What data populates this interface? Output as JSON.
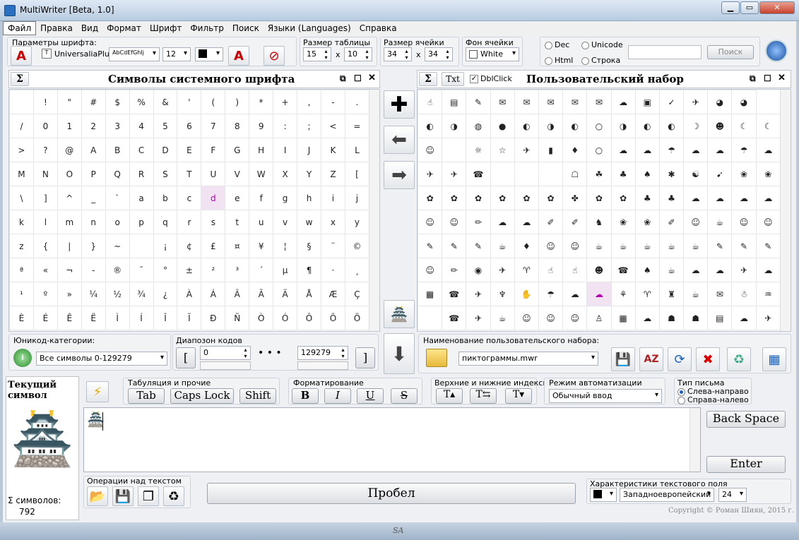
{
  "window": {
    "title": "MultiWriter [Beta, 1.0]"
  },
  "menu": [
    "Файл",
    "Правка",
    "Вид",
    "Формат",
    "Шрифт",
    "Фильтр",
    "Поиск",
    "Языки (Languages)",
    "Справка"
  ],
  "font_params": {
    "label": "Параметры шрифта:",
    "font_name": "UniversaliaPlus",
    "font_sample": "AbCdEfGhIj",
    "font_size": "12"
  },
  "table_size": {
    "label": "Размер таблицы",
    "cols": "15",
    "x": "x",
    "rows": "10"
  },
  "cell_size": {
    "label": "Размер ячейки",
    "w": "34",
    "x": "x",
    "h": "34"
  },
  "cell_bg": {
    "label": "Фон ячейки",
    "value": "White"
  },
  "search": {
    "dec": "Dec",
    "unicode": "Unicode",
    "html": "Html",
    "string": "Строка",
    "button": "Поиск",
    "value": ""
  },
  "system_panel": {
    "sigma": "Σ",
    "title": "Символы системного шрифта"
  },
  "system_grid": [
    [
      "",
      "!",
      "\"",
      "#",
      "$",
      "%",
      "&",
      "'",
      "(",
      ")",
      "*",
      "+",
      ",",
      "-",
      "."
    ],
    [
      "/",
      "0",
      "1",
      "2",
      "3",
      "4",
      "5",
      "6",
      "7",
      "8",
      "9",
      ":",
      ";",
      "<",
      "="
    ],
    [
      ">",
      "?",
      "@",
      "A",
      "B",
      "C",
      "D",
      "E",
      "F",
      "G",
      "H",
      "I",
      "J",
      "K",
      "L"
    ],
    [
      "M",
      "N",
      "O",
      "P",
      "Q",
      "R",
      "S",
      "T",
      "U",
      "V",
      "W",
      "X",
      "Y",
      "Z",
      "["
    ],
    [
      "\\",
      "]",
      "^",
      "_",
      "`",
      "a",
      "b",
      "c",
      "d",
      "e",
      "f",
      "g",
      "h",
      "i",
      "j"
    ],
    [
      "k",
      "l",
      "m",
      "n",
      "o",
      "p",
      "q",
      "r",
      "s",
      "t",
      "u",
      "v",
      "w",
      "x",
      "y"
    ],
    [
      "z",
      "{",
      "|",
      "}",
      "~",
      "",
      "¡",
      "¢",
      "£",
      "¤",
      "¥",
      "¦",
      "§",
      "¨",
      "©"
    ],
    [
      "ª",
      "«",
      "¬",
      "-",
      "®",
      "¯",
      "°",
      "±",
      "²",
      "³",
      "´",
      "µ",
      "¶",
      "·",
      "¸"
    ],
    [
      "¹",
      "º",
      "»",
      "¼",
      "½",
      "¾",
      "¿",
      "À",
      "Á",
      "Â",
      "Ã",
      "Ä",
      "Å",
      "Æ",
      "Ç"
    ],
    [
      "È",
      "É",
      "Ê",
      "Ë",
      "Ì",
      "Í",
      "Î",
      "Ï",
      "Ð",
      "Ñ",
      "Ò",
      "Ó",
      "Ô",
      "Õ",
      "Ö"
    ]
  ],
  "user_panel": {
    "sigma": "Σ",
    "txt": "Txt",
    "dblclick": "DblClick",
    "title": "Пользовательский набор"
  },
  "user_grid": [
    [
      "☝",
      "▤",
      "✎",
      "✉",
      "✉",
      "✉",
      "✉",
      "✉",
      "☁",
      "▣",
      "✓",
      "✈",
      "◕",
      "◕"
    ],
    [
      "◐",
      "◑",
      "◍",
      "●",
      "◐",
      "◑",
      "◐",
      "○",
      "◑",
      "◐",
      "◐",
      "☽",
      "☻",
      "☾",
      "☾"
    ],
    [
      "☺",
      "",
      "☼",
      "☆",
      "✈",
      "▮",
      "♦",
      "○",
      "☁",
      "☁",
      "☂",
      "☁",
      "☁",
      "☂",
      "☁"
    ],
    [
      "✈",
      "✈",
      "☎",
      "",
      "",
      "",
      "☖",
      "☘",
      "♣",
      "♠",
      "✱",
      "☯",
      "➹",
      "❀",
      "❀"
    ],
    [
      "✿",
      "✿",
      "✿",
      "✿",
      "✿",
      "✿",
      "✤",
      "✿",
      "✿",
      "♣",
      "♣",
      "☁",
      "☁",
      "☁",
      "☁"
    ],
    [
      "☺",
      "☺",
      "✏",
      "☁",
      "☁",
      "✐",
      "✐",
      "♞",
      "❀",
      "❀",
      "✐",
      "☺",
      "☕",
      "☺",
      "☺"
    ],
    [
      "✎",
      "✎",
      "✎",
      "☕",
      "♦",
      "☺",
      "☺",
      "☕",
      "☕",
      "☕",
      "☕",
      "☕",
      "✎",
      "✎",
      "✎"
    ],
    [
      "☺",
      "✏",
      "◉",
      "✈",
      "♈",
      "☝",
      "☝",
      "☻",
      "☎",
      "♠",
      "☕",
      "☁",
      "☁",
      "✈",
      "☁"
    ],
    [
      "▦",
      "☎",
      "✈",
      "♆",
      "✋",
      "☂",
      "☁",
      "☁",
      "⚘",
      "♈",
      "♜",
      "☕",
      "✉",
      "☃",
      "♒"
    ],
    [
      "",
      "☎",
      "✈",
      "☕",
      "☺",
      "☺",
      "☺",
      "♙",
      "▦",
      "☁",
      "☗",
      "☗",
      "▤",
      "☁",
      "✈"
    ]
  ],
  "unicode_cat": {
    "label": "Юникод-категории:",
    "value": "Все символы 0-129279"
  },
  "code_range": {
    "label": "Диапозон кодов",
    "from": "0",
    "to": "129279",
    "bracket_l": "[",
    "bracket_r": "]"
  },
  "user_set_name": {
    "label": "Наименование пользовательского набора:",
    "value": "пиктограммы.mwr"
  },
  "current_symbol": {
    "label": "Текущий символ",
    "glyph": "🏯"
  },
  "count": {
    "label": "Σ символов:",
    "value": "792"
  },
  "tab_group": {
    "label": "Табуляция и прочие",
    "tab": "Tab",
    "caps": "Caps Lock",
    "shift": "Shift"
  },
  "format_group": {
    "label": "Форматирование",
    "b": "B",
    "i": "I",
    "u": "U",
    "s": "S"
  },
  "index_group": {
    "label": "Верхние и нижние индексы"
  },
  "auto_group": {
    "label": "Режим автоматизации",
    "value": "Обычный ввод"
  },
  "writing_group": {
    "label": "Тип письма",
    "ltr": "Слева-направо",
    "rtl": "Справа-налево"
  },
  "editor": {
    "text": "🏯"
  },
  "keys": {
    "backspace": "Back Space",
    "enter": "Enter",
    "space": "Пробел"
  },
  "ops": {
    "label": "Операции над текстом"
  },
  "field_props": {
    "label": "Характеристики текстового поля",
    "encoding": "Западноевропейский",
    "size": "24"
  },
  "copyright": "Copyright © Роман Шиян, 2015 г.",
  "taskbar_logo": "SA"
}
